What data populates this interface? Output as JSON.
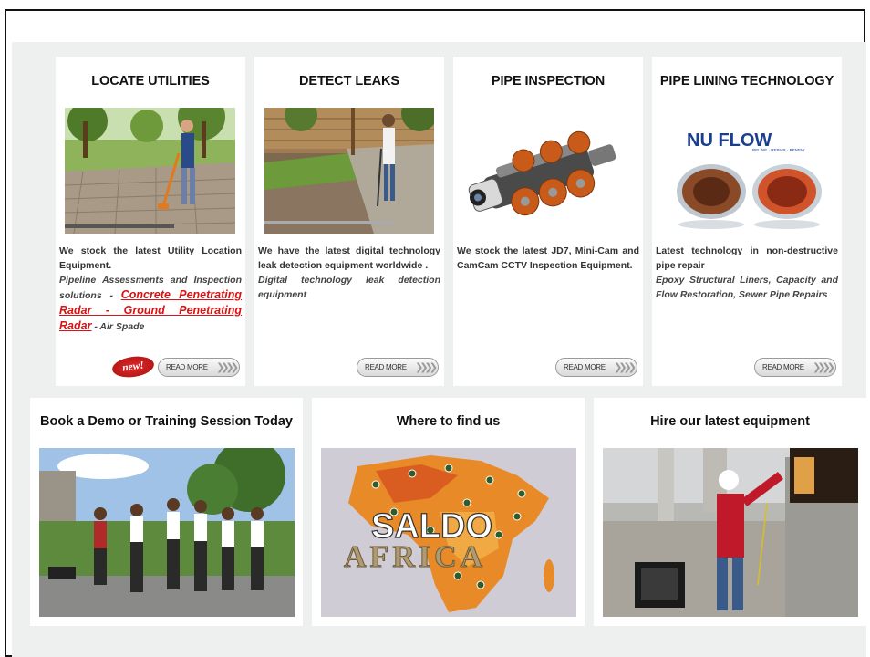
{
  "colors": {
    "panel_bg": "#edf0ef",
    "card_bg": "#ffffff",
    "link_red": "#d81313",
    "badge_red": "#c41a1a"
  },
  "cards": [
    {
      "title": "LOCATE UTILITIES",
      "image_icon": "utility-locator-photo",
      "desc_bold": "We stock the latest Utility Location Equipment.",
      "desc_italic": "Pipeline Assessments and Inspection solutions - ",
      "desc_link": "Concrete Penetrating Radar - Ground Penetrating Radar",
      "desc_tail": " - Air Spade",
      "badge": "new!",
      "read_more": "READ MORE"
    },
    {
      "title": "DETECT LEAKS",
      "image_icon": "leak-detection-photo",
      "desc_bold": "We have the latest digital technology leak detection equipment worldwide .",
      "desc_italic": "Digital technology leak detection equipment",
      "read_more": "READ MORE"
    },
    {
      "title": "PIPE INSPECTION",
      "image_icon": "pipe-crawler-camera-photo",
      "desc_bold": "We stock the latest JD7, Mini-Cam and CamCam CCTV Inspection Equipment.",
      "read_more": "READ MORE"
    },
    {
      "title": "PIPE LINING TECHNOLOGY",
      "image_icon": "nu-flow-pipe-photo",
      "logo_text": "NU FLOW",
      "desc_bold": "Latest technology in non-destructive pipe repair",
      "desc_italic": "Epoxy Structural Liners, Capacity and Flow Restoration, Sewer Pipe Repairs",
      "read_more": "READ MORE"
    }
  ],
  "bottom_cards": [
    {
      "title": "Book a Demo or Training Session Today",
      "image_icon": "training-group-photo"
    },
    {
      "title": "Where to find us",
      "image_icon": "africa-map",
      "map_text_1": "SALDO",
      "map_text_2": "AFRICA"
    },
    {
      "title": "Hire our latest equipment",
      "image_icon": "equipment-hire-photo"
    }
  ]
}
